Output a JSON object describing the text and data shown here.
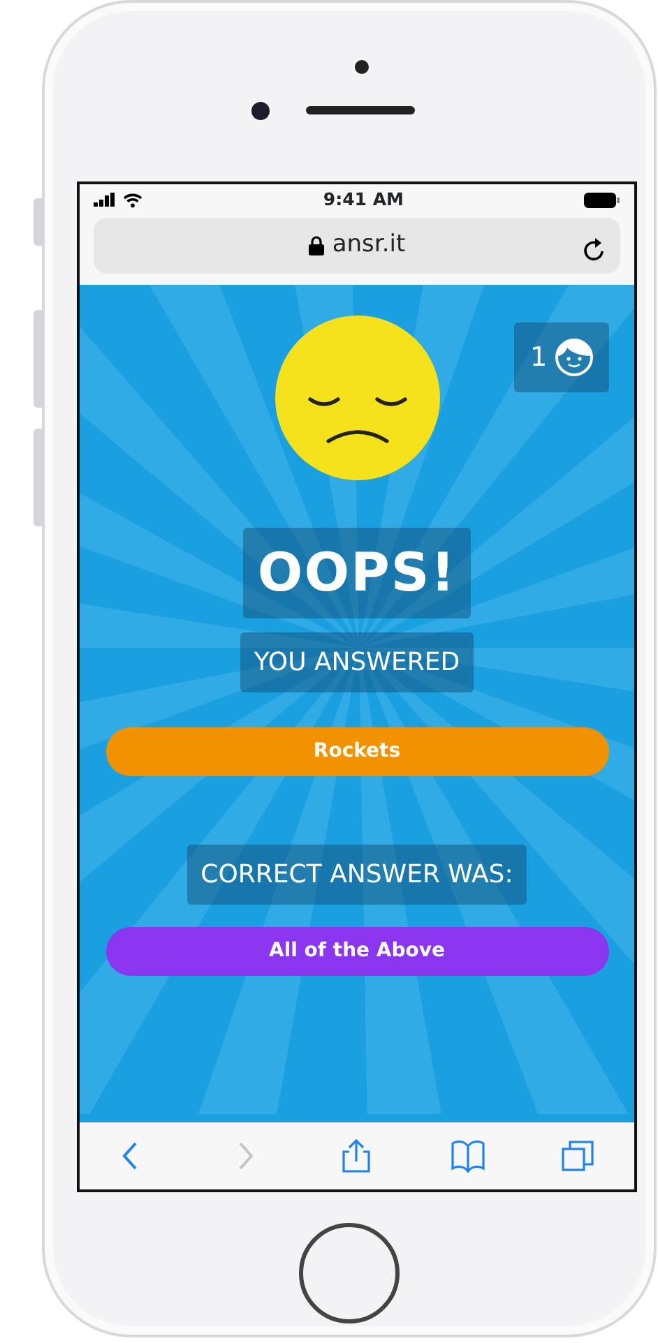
{
  "status_bar": {
    "time": "9:41 AM"
  },
  "address_bar": {
    "url": "ansr.it"
  },
  "score": {
    "count": "1"
  },
  "result": {
    "title": "OOPS!",
    "answered_label": "YOU ANSWERED",
    "your_answer": "Rockets",
    "correct_label": "CORRECT ANSWER WAS:",
    "correct_answer": "All of the Above"
  },
  "toolbar": [
    {
      "kind": "back",
      "disabled": false
    },
    {
      "kind": "forward",
      "disabled": true
    },
    {
      "kind": "share",
      "disabled": false
    },
    {
      "kind": "bookmarks",
      "disabled": false
    },
    {
      "kind": "tabs",
      "disabled": false
    }
  ]
}
